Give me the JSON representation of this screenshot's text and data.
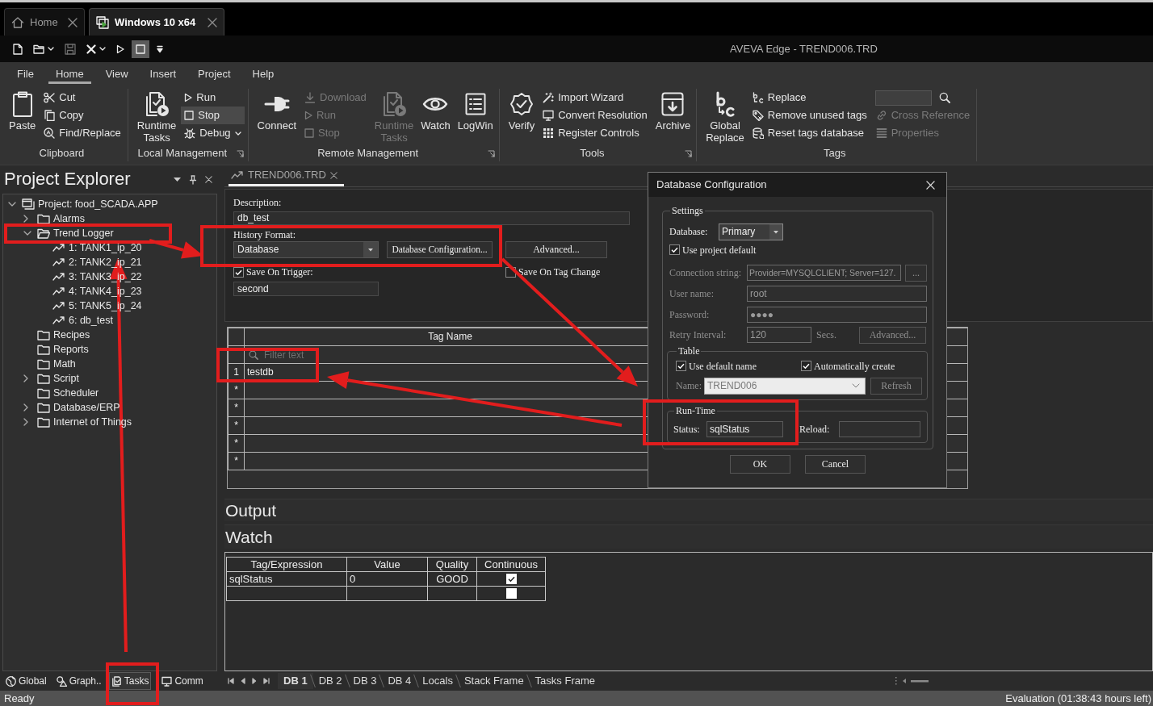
{
  "browser_tabs": [
    {
      "label": "Home",
      "selected": false
    },
    {
      "label": "Windows 10 x64",
      "selected": true
    }
  ],
  "quick_access": [
    {
      "dropdown": false,
      "disabled": false,
      "pressed": false
    },
    {
      "dropdown": true,
      "disabled": false,
      "pressed": false
    },
    {
      "dropdown": false,
      "disabled": true,
      "pressed": false
    },
    {
      "dropdown": true,
      "disabled": false,
      "pressed": false
    },
    {
      "dropdown": false,
      "disabled": false,
      "pressed": false
    },
    {
      "dropdown": false,
      "disabled": false,
      "pressed": true
    },
    {
      "dropdown": false,
      "disabled": false,
      "pressed": false
    }
  ],
  "window": {
    "title": "AVEVA Edge - TREND006.TRD"
  },
  "ribbon": {
    "tabs": [
      {
        "label": "File",
        "selected": false
      },
      {
        "label": "Home",
        "selected": true
      },
      {
        "label": "View",
        "selected": false
      },
      {
        "label": "Insert",
        "selected": false
      },
      {
        "label": "Project",
        "selected": false
      },
      {
        "label": "Help",
        "selected": false
      }
    ],
    "groups": [
      {
        "label": "Clipboard",
        "launcher": false,
        "items": [
          {
            "kind": "large",
            "label": "Paste",
            "disabled": false,
            "pressed": false
          },
          {
            "kind": "small",
            "label": "Cut",
            "disabled": false,
            "pressed": false
          },
          {
            "kind": "small",
            "label": "Copy",
            "disabled": false,
            "pressed": false
          },
          {
            "kind": "small",
            "label": "Find/Replace",
            "disabled": false,
            "pressed": false
          }
        ]
      },
      {
        "label": "Local Management",
        "launcher": true,
        "items": [
          {
            "kind": "large",
            "label": "Runtime Tasks",
            "disabled": false,
            "pressed": false
          },
          {
            "kind": "small",
            "label": "Run",
            "disabled": false,
            "pressed": false
          },
          {
            "kind": "small",
            "label": "Stop",
            "disabled": false,
            "pressed": true
          },
          {
            "kind": "small_dropdown",
            "label": "Debug",
            "disabled": false,
            "pressed": false
          }
        ]
      },
      {
        "label": "Remote Management",
        "launcher": true,
        "items": [
          {
            "kind": "large",
            "label": "Connect",
            "disabled": false,
            "pressed": false
          },
          {
            "kind": "small",
            "label": "Download",
            "disabled": true,
            "pressed": false
          },
          {
            "kind": "small",
            "label": "Run",
            "disabled": true,
            "pressed": false
          },
          {
            "kind": "small",
            "label": "Stop",
            "disabled": true,
            "pressed": false
          },
          {
            "kind": "large",
            "label": "Runtime Tasks",
            "disabled": true,
            "pressed": false
          },
          {
            "kind": "large",
            "label": "Watch",
            "disabled": false,
            "pressed": false
          },
          {
            "kind": "large",
            "label": "LogWin",
            "disabled": false,
            "pressed": false
          }
        ]
      },
      {
        "label": "Tools",
        "launcher": true,
        "items": [
          {
            "kind": "large",
            "label": "Verify",
            "disabled": false,
            "pressed": false
          },
          {
            "kind": "small",
            "label": "Import Wizard",
            "disabled": false,
            "pressed": false
          },
          {
            "kind": "small",
            "label": "Convert Resolution",
            "disabled": false,
            "pressed": false
          },
          {
            "kind": "small",
            "label": "Register Controls",
            "disabled": false,
            "pressed": false
          },
          {
            "kind": "large",
            "label": "Archive",
            "disabled": false,
            "pressed": false
          }
        ]
      },
      {
        "label": "Tags",
        "launcher": false,
        "items": [
          {
            "kind": "large",
            "label": "Global Replace",
            "disabled": false,
            "pressed": false
          },
          {
            "kind": "small",
            "label": "Replace",
            "disabled": false,
            "pressed": false
          },
          {
            "kind": "small",
            "label": "Remove unused tags",
            "disabled": false,
            "pressed": false
          },
          {
            "kind": "small",
            "label": "Reset tags database",
            "disabled": false,
            "pressed": false
          },
          {
            "kind": "search",
            "disabled": false,
            "pressed": false
          },
          {
            "kind": "small",
            "label": "Cross Reference",
            "disabled": true,
            "pressed": false
          },
          {
            "kind": "small",
            "label": "Properties",
            "disabled": true,
            "pressed": false
          }
        ]
      }
    ]
  },
  "explorer": {
    "title": "Project Explorer",
    "tree": [
      {
        "kind": "project",
        "label": "Project: food_SCADA.APP",
        "has_children": true,
        "expanded": true,
        "children": [
          {
            "kind": "folder",
            "label": "Alarms",
            "has_children": true,
            "expanded": false
          },
          {
            "kind": "folder",
            "label": "Trend Logger",
            "has_children": true,
            "expanded": true,
            "children": [
              {
                "kind": "trend",
                "label": "1: TANK1_ip_20",
                "has_children": false,
                "expanded": false
              },
              {
                "kind": "trend",
                "label": "2: TANK2_ip_21",
                "has_children": false,
                "expanded": false
              },
              {
                "kind": "trend",
                "label": "3: TANK3_ip_22",
                "has_children": false,
                "expanded": false
              },
              {
                "kind": "trend",
                "label": "4: TANK4_ip_23",
                "has_children": false,
                "expanded": false
              },
              {
                "kind": "trend",
                "label": "5: TANK5_ip_24",
                "has_children": false,
                "expanded": false
              },
              {
                "kind": "trend",
                "label": "6: db_test",
                "has_children": false,
                "expanded": false
              }
            ]
          },
          {
            "kind": "folder",
            "label": "Recipes",
            "has_children": false,
            "expanded": false
          },
          {
            "kind": "folder",
            "label": "Reports",
            "has_children": false,
            "expanded": false
          },
          {
            "kind": "folder",
            "label": "Math",
            "has_children": false,
            "expanded": false
          },
          {
            "kind": "folder",
            "label": "Script",
            "has_children": true,
            "expanded": false
          },
          {
            "kind": "folder",
            "label": "Scheduler",
            "has_children": false,
            "expanded": false
          },
          {
            "kind": "folder",
            "label": "Database/ERP",
            "has_children": true,
            "expanded": false
          },
          {
            "kind": "folder",
            "label": "Internet of Things",
            "has_children": true,
            "expanded": false
          }
        ]
      }
    ],
    "tabs": [
      {
        "label": "Global",
        "selected": false
      },
      {
        "label": "Graph..",
        "selected": false
      },
      {
        "label": "Tasks",
        "selected": true
      },
      {
        "label": "Comm",
        "selected": false
      }
    ]
  },
  "document": {
    "tab": {
      "label": "TREND006.TRD",
      "selected": true
    },
    "form": {
      "description_label": "Description:",
      "description": "db_test",
      "history_format_label": "History Format:",
      "history_format": "Database",
      "config_button": "Database Configuration...",
      "advanced_button": "Advanced...",
      "save_on_trigger": {
        "label": "Save On Trigger:",
        "checked": true
      },
      "trigger_tag": "second",
      "save_on_tag_change": {
        "label": "Save On Tag Change",
        "checked": false
      }
    },
    "grid": {
      "columns": [
        "Tag Name"
      ],
      "filter_placeholder": "Filter text",
      "rows": [
        {
          "marker": "1",
          "tag_name": "testdb"
        },
        {
          "marker": "*"
        },
        {
          "marker": "*"
        },
        {
          "marker": "*"
        },
        {
          "marker": "*"
        },
        {
          "marker": "*"
        }
      ]
    }
  },
  "dialog": {
    "title": "Database Configuration",
    "settings": {
      "legend": "Settings",
      "database_label": "Database:",
      "database": "Primary",
      "use_project_default": {
        "label": "Use project default",
        "checked": true
      },
      "connection_string": {
        "label": "Connection string:",
        "value": "Provider=MYSQLCLIENT; Server=127.",
        "disabled": true
      },
      "browse_button": {
        "label": "...",
        "disabled": true
      },
      "user_name": {
        "label": "User name:",
        "value": "root",
        "disabled": true
      },
      "password": {
        "label": "Password:",
        "value": "●●●●",
        "disabled": true
      },
      "retry_interval": {
        "label": "Retry Interval:",
        "value": "120",
        "unit": "Secs.",
        "disabled": true
      },
      "advanced_button": {
        "label": "Advanced...",
        "disabled": true
      }
    },
    "table": {
      "legend": "Table",
      "use_default_name": {
        "label": "Use default name",
        "checked": true
      },
      "automatically_create": {
        "label": "Automatically create",
        "checked": true
      },
      "name": {
        "label": "Name:",
        "value": "TREND006",
        "disabled": true
      },
      "refresh_button": {
        "label": "Refresh",
        "disabled": true
      }
    },
    "run_time": {
      "legend": "Run-Time",
      "status_label": "Status:",
      "status": "sqlStatus",
      "reload_label": "Reload:"
    },
    "buttons": [
      "OK",
      "Cancel"
    ]
  },
  "output": {
    "title": "Output"
  },
  "watch": {
    "title": "Watch",
    "columns": [
      "Tag/Expression",
      "Value",
      "Quality",
      "Continuous"
    ],
    "rows": [
      {
        "tag": "sqlStatus",
        "value": "0",
        "quality": "GOOD",
        "continuous": true
      },
      {
        "continuous": false
      }
    ]
  },
  "debug_tabs": [
    {
      "label": "DB 1",
      "selected": true
    },
    {
      "label": "DB 2",
      "selected": false
    },
    {
      "label": "DB 3",
      "selected": false
    },
    {
      "label": "DB 4",
      "selected": false
    },
    {
      "label": "Locals",
      "selected": false
    },
    {
      "label": "Stack Frame",
      "selected": false
    },
    {
      "label": "Tasks Frame",
      "selected": false
    }
  ],
  "status_bar": {
    "left": "Ready",
    "right": "Evaluation (01:38:43 hours left)"
  },
  "annotations": [
    {
      "kind": "box"
    },
    {
      "kind": "arrow"
    },
    {
      "kind": "box"
    },
    {
      "kind": "arrow"
    },
    {
      "kind": "box"
    },
    {
      "kind": "box"
    },
    {
      "kind": "arrow"
    },
    {
      "kind": "box"
    },
    {
      "kind": "arrow"
    }
  ]
}
